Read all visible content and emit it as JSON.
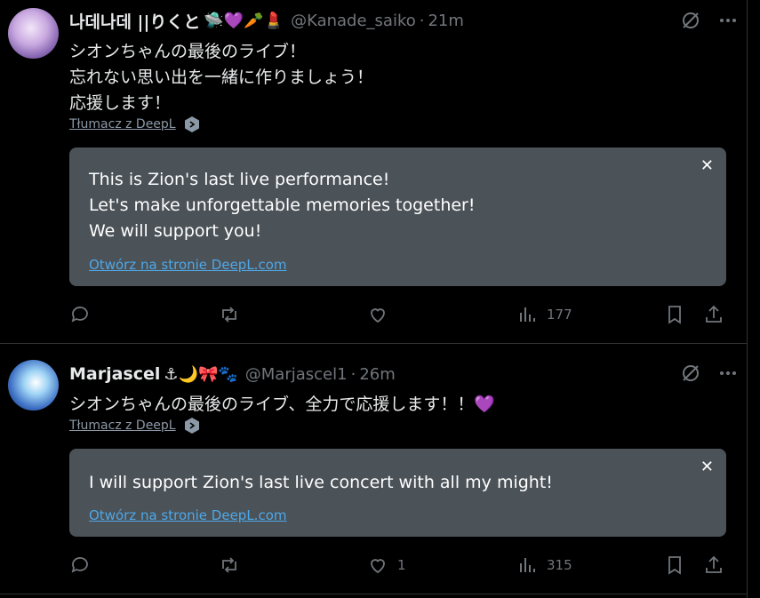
{
  "tweets": [
    {
      "name": "나데나데 ||りくと",
      "emojis": "🛸💜🥕💄",
      "handle": "@Kanade_saiko",
      "time": "21m",
      "lines": [
        "シオンちゃんの最後のライブ！",
        "忘れない思い出を一緒に作りましょう！",
        "応援します！"
      ],
      "translate_label": "Tłumacz z DeepL",
      "deepl_lines": [
        "This is Zion's last live performance!",
        "Let's make unforgettable memories together!",
        "We will support you!"
      ],
      "deepl_link": "Otwórz na stronie DeepL.com",
      "close": "✕",
      "likes": "",
      "views": "177"
    },
    {
      "name": "Marjascel",
      "emojis": "⚓🌙🎀🐾",
      "handle": "@Marjascel1",
      "time": "26m",
      "lines": [
        "シオンちゃんの最後のライブ、全力で応援します！！💜"
      ],
      "translate_label": "Tłumacz z DeepL",
      "deepl_lines": [
        "I will support Zion's last live concert with all my might!"
      ],
      "deepl_link": "Otwórz na stronie DeepL.com",
      "close": "✕",
      "likes": "1",
      "views": "315"
    }
  ],
  "separator": "·"
}
